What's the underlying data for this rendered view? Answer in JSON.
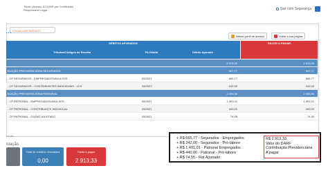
{
  "header": {
    "titular": "Titular (Acesso ICOLIBR por Certificado)",
    "responsavel": "Responsável Legal",
    "security_link": "Sair com Segurança"
  },
  "toolbar": {
    "search_placeholder": "LOCALIZAR SERVIÇO",
    "alterar_perfil": "Alterar perfil de acesso",
    "voltar": "Voltar a sua página"
  },
  "table": {
    "debitos_apurados": "DÉBITOS APURADOS",
    "saldo_a_pagar": "SALDO A PAGAR",
    "col_tributos": "Tributos/Códigos de Receita",
    "col_pa": "PA Débito",
    "col_debito": "Débito Apurado",
    "rows": [
      {
        "desc": "",
        "pa": "",
        "deb": "2.913,33",
        "saldo": "2.913,33",
        "type": "group"
      },
      {
        "desc": "BUIÇÃO PREVIDENCIÁRIA SEGURADOS",
        "pa": "",
        "deb": "907,77",
        "saldo": "907,77",
        "type": "group"
      },
      {
        "desc": "- CP SEGURADOS - EMPREGADOS/AVULSOS",
        "pa": "05/2021",
        "deb": "665,77",
        "saldo": "665,77",
        "type": "plain"
      },
      {
        "desc": "- CP SEGURADOS - CONTRIBUINTES INDIVIDUAIS - 11%",
        "pa": "05/2021",
        "deb": "242,00",
        "saldo": "242,00",
        "type": "alt"
      },
      {
        "desc": "BUIÇÃO PREVIDENCIÁRIA PATRONAL",
        "pa": "",
        "deb": "2.005,56",
        "saldo": "2.005,56",
        "type": "group"
      },
      {
        "desc": "- CP PATRONAL - EMPREGADOS/AVULSOS",
        "pa": "05/2021",
        "deb": "1.491,01",
        "saldo": "1.491,01",
        "type": "plain"
      },
      {
        "desc": "- CP PATRONAL - CONTRIBUINTE INDIVIDUAL",
        "pa": "05/2021",
        "deb": "440,00",
        "saldo": "440,00",
        "type": "alt"
      },
      {
        "desc": "- CP PATRONAL - GILRAT AJUSTADO",
        "pa": "05/2021",
        "deb": "74,55",
        "saldo": "74,55",
        "type": "plain"
      }
    ]
  },
  "summary": {
    "label_top": "uação",
    "label_section": "tuação",
    "card_total_debitos_label": "",
    "card_total_creditos_label": "Total de créditos vinculados",
    "card_total_creditos_value": "0,00",
    "card_saldo_label": "Saldo a pagar",
    "card_saldo_value": "2.913,33"
  },
  "note": {
    "lines": [
      "+ R$ 665,77 - Segurados - Empregados",
      "+ R$ 242,00 - Segurados - Pró-labore",
      "+ R$ 1.491,01 - Patronal Empregados",
      "+ R$ 440,00 - Patronal - Pró-labore",
      "+ R$ 74,55 - Rat Ajustado"
    ],
    "total_lines": [
      "R$ 2.913,33",
      "Valor do DARF",
      "Contribuição Previdenciária",
      "A pagar"
    ]
  }
}
